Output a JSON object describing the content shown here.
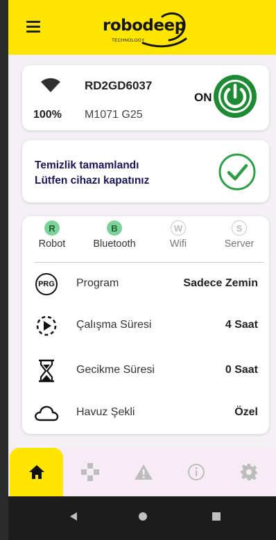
{
  "app": {
    "brand": "robodeep",
    "brand_sub": "TECHNOLOGY",
    "accent_color": "#ffe600",
    "success_color": "#1f8a34",
    "menu_icon": "hamburger-menu-icon"
  },
  "status": {
    "battery": "100%",
    "device_id": "RD2GD6037",
    "model": "M1071 G25",
    "power_state": "ON",
    "wifi_icon": "wifi-icon",
    "power_icon": "power-icon"
  },
  "message": {
    "line1": "Temizlik tamamlandı",
    "line2": "Lütfen cihazı kapatınız",
    "icon": "check-circle-icon"
  },
  "connections": [
    {
      "letter": "R",
      "label": "Robot",
      "active": true
    },
    {
      "letter": "B",
      "label": "Bluetooth",
      "active": true
    },
    {
      "letter": "W",
      "label": "Wifi",
      "active": false
    },
    {
      "letter": "S",
      "label": "Server",
      "active": false
    }
  ],
  "settings": {
    "program": {
      "icon_text": "PRG",
      "label": "Program",
      "value": "Sadece Zemin"
    },
    "work_time": {
      "label": "Çalışma Süresi",
      "value": "4 Saat"
    },
    "delay_time": {
      "label": "Gecikme Süresi",
      "value": "0 Saat"
    },
    "pool_shape": {
      "label": "Havuz Şekli",
      "value": "Özel"
    }
  },
  "bottom_nav": {
    "items": [
      "home-icon",
      "control-pad-icon",
      "warning-icon",
      "info-icon",
      "settings-gear-icon"
    ],
    "active_index": 0
  },
  "system_nav": [
    "back-icon",
    "home-circle-icon",
    "recents-icon"
  ]
}
